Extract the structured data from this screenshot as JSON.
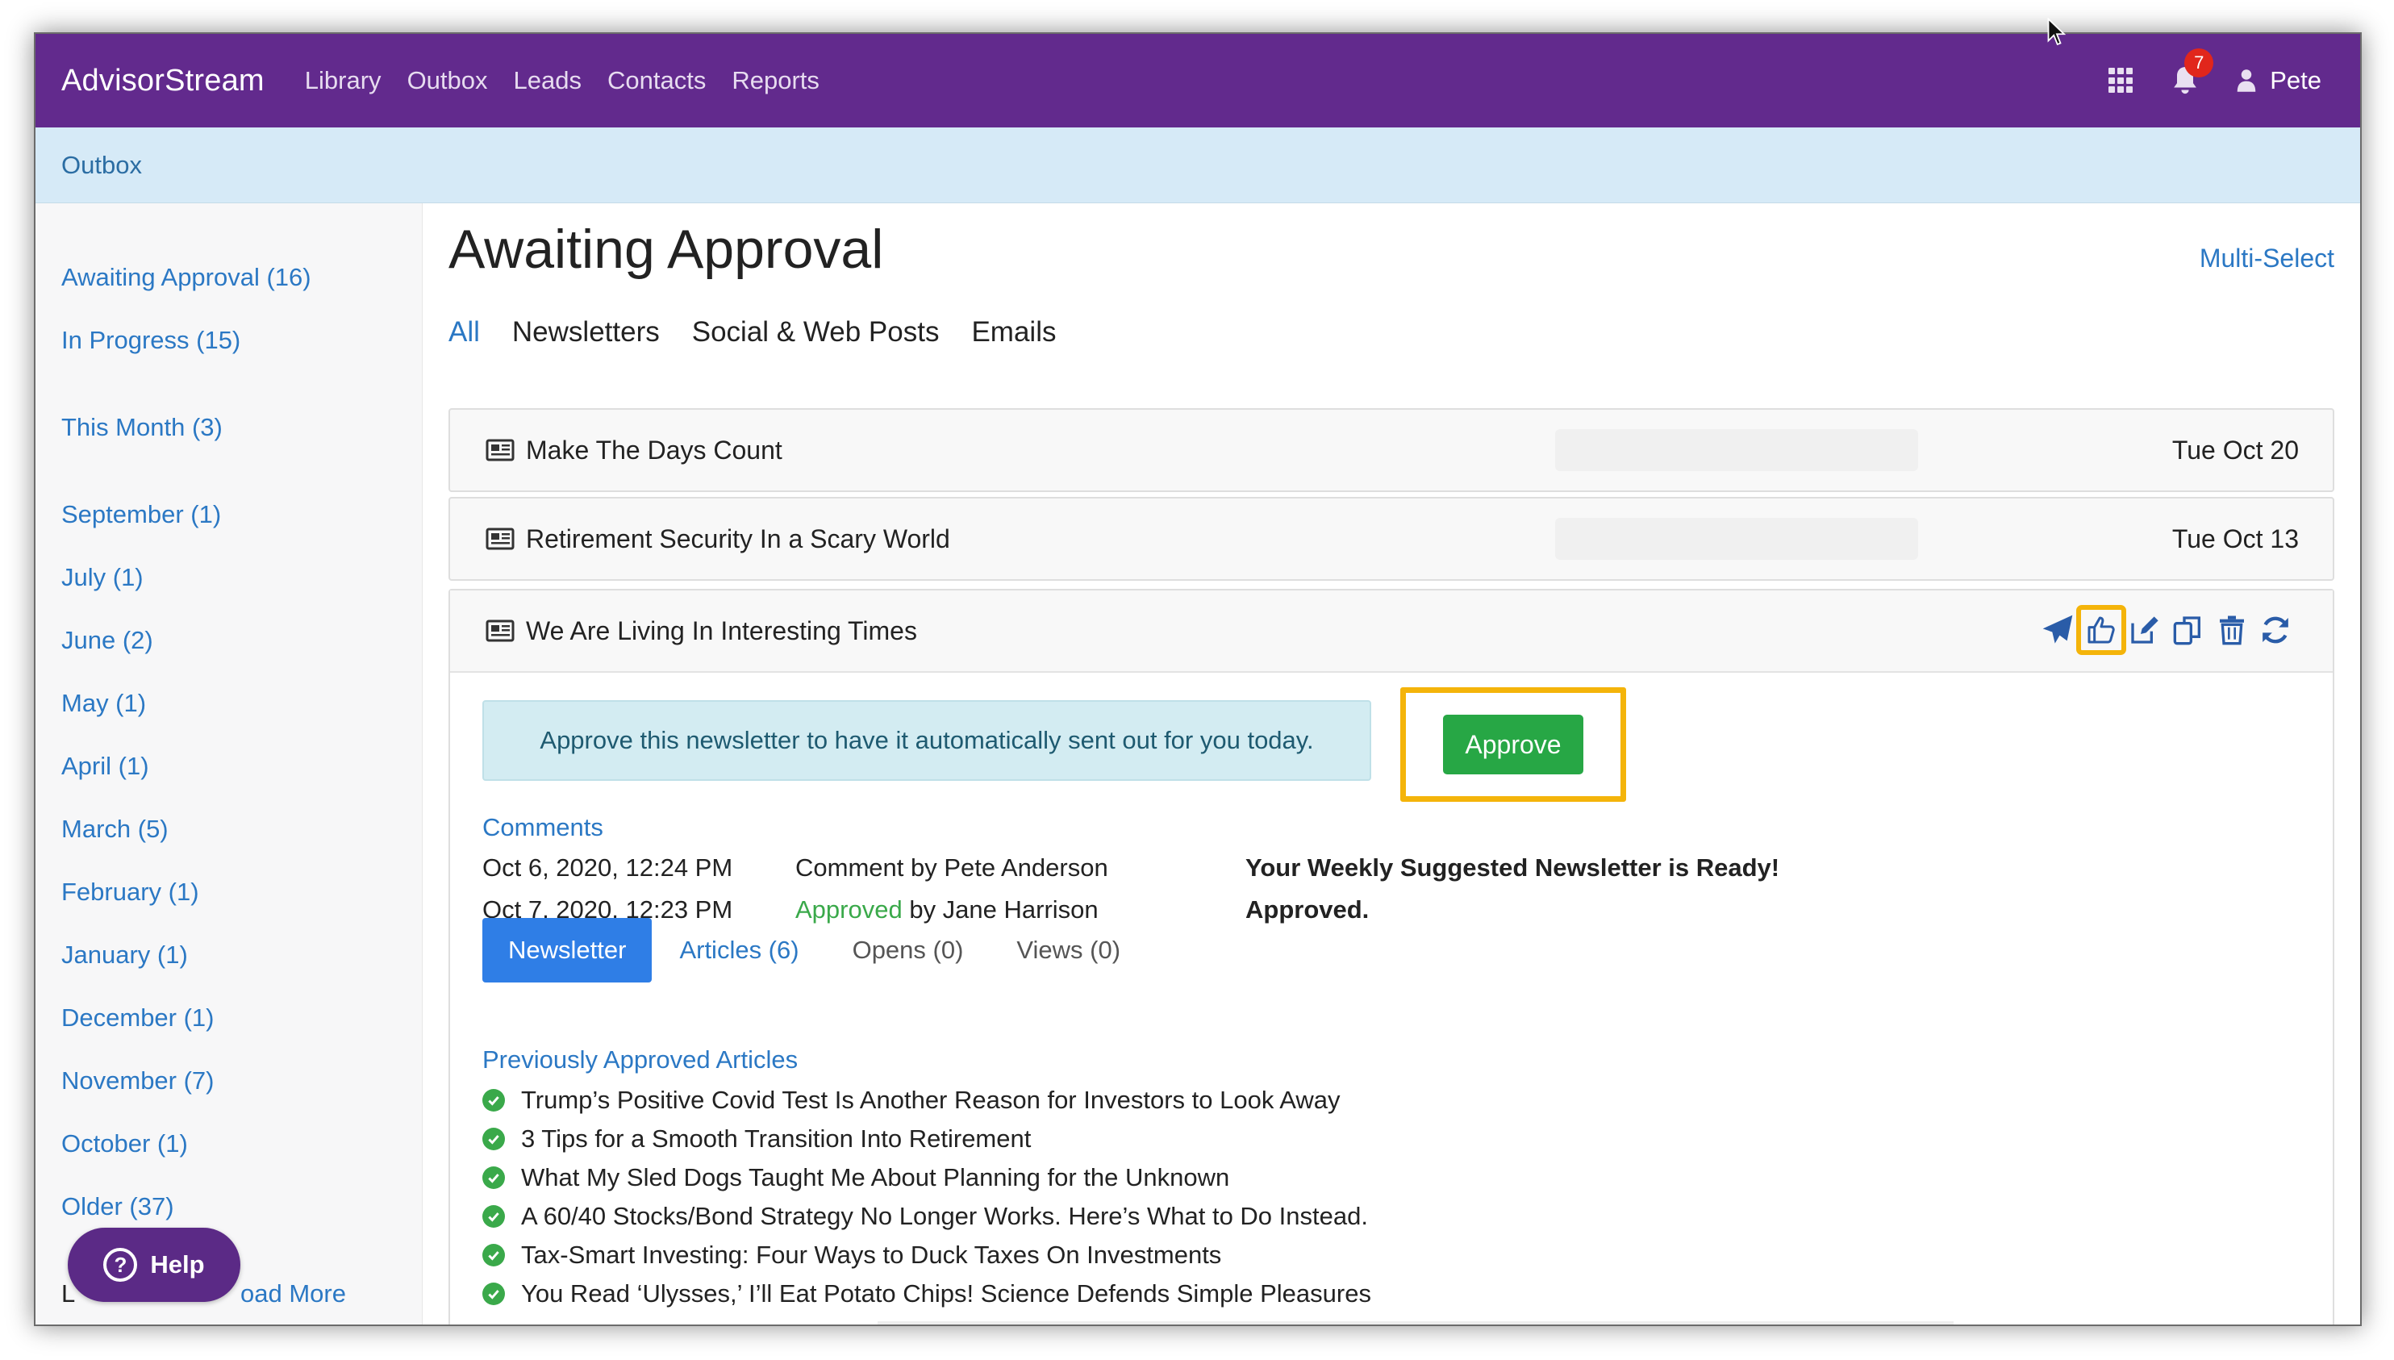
{
  "navbar": {
    "brand": "AdvisorStream",
    "links": [
      "Library",
      "Outbox",
      "Leads",
      "Contacts",
      "Reports"
    ],
    "notification_count": "7",
    "user_name": "Pete"
  },
  "breadcrumb": "Outbox",
  "sidebar": {
    "items": [
      "Awaiting Approval (16)",
      "In Progress (15)",
      "This Month (3)",
      "September (1)",
      "July (1)",
      "June (2)",
      "May (1)",
      "April (1)",
      "March (5)",
      "February (1)",
      "January (1)",
      "December (1)",
      "November (7)",
      "October (1)",
      "Older (37)"
    ],
    "load_more_prefix": "L",
    "load_more": "oad More",
    "help": "Help"
  },
  "main": {
    "title": "Awaiting Approval",
    "multi_select": "Multi-Select",
    "filters": [
      "All",
      "Newsletters",
      "Social & Web Posts",
      "Emails"
    ],
    "rows": [
      {
        "title": "Make The Days Count",
        "date": "Tue Oct 20"
      },
      {
        "title": "Retirement Security In a Scary World",
        "date": "Tue Oct 13"
      }
    ],
    "expanded": {
      "title": "We Are Living In Interesting Times",
      "approve_message": "Approve this newsletter to have it automatically sent out for you today.",
      "approve_button": "Approve",
      "comments_label": "Comments",
      "comments": [
        {
          "date": "Oct 6, 2020, 12:24 PM",
          "by_prefix": "Comment by Pete Anderson",
          "status": "",
          "by_suffix": "",
          "text": "Your Weekly Suggested Newsletter is Ready!"
        },
        {
          "date": "Oct 7, 2020, 12:23 PM",
          "by_prefix": "",
          "status": "Approved",
          "by_suffix": " by Jane Harrison",
          "text": "Approved."
        }
      ],
      "tabs": [
        "Newsletter",
        "Articles (6)",
        "Opens (0)",
        "Views (0)"
      ],
      "previously_approved_label": "Previously Approved Articles",
      "articles": [
        "Trump’s Positive Covid Test Is Another Reason for Investors to Look Away",
        "3 Tips for a Smooth Transition Into Retirement",
        "What My Sled Dogs Taught Me About Planning for the Unknown",
        "A 60/40 Stocks/Bond Strategy No Longer Works. Here’s What to Do Instead.",
        "Tax-Smart Investing: Four Ways to Duck Taxes On Investments",
        "You Read ‘Ulysses,’ I’ll Eat Potato Chips! Science Defends Simple Pleasures"
      ]
    }
  },
  "colors": {
    "navbar": "#622a8d",
    "link": "#2b78c4",
    "approve": "#27a745",
    "highlight": "#f4b40a"
  },
  "icons": [
    "grid-icon",
    "bell-icon",
    "user-icon",
    "newsletter-icon",
    "send-icon",
    "thumbs-up-icon",
    "edit-icon",
    "copy-icon",
    "trash-icon",
    "refresh-icon",
    "check-circle-icon",
    "question-icon"
  ]
}
